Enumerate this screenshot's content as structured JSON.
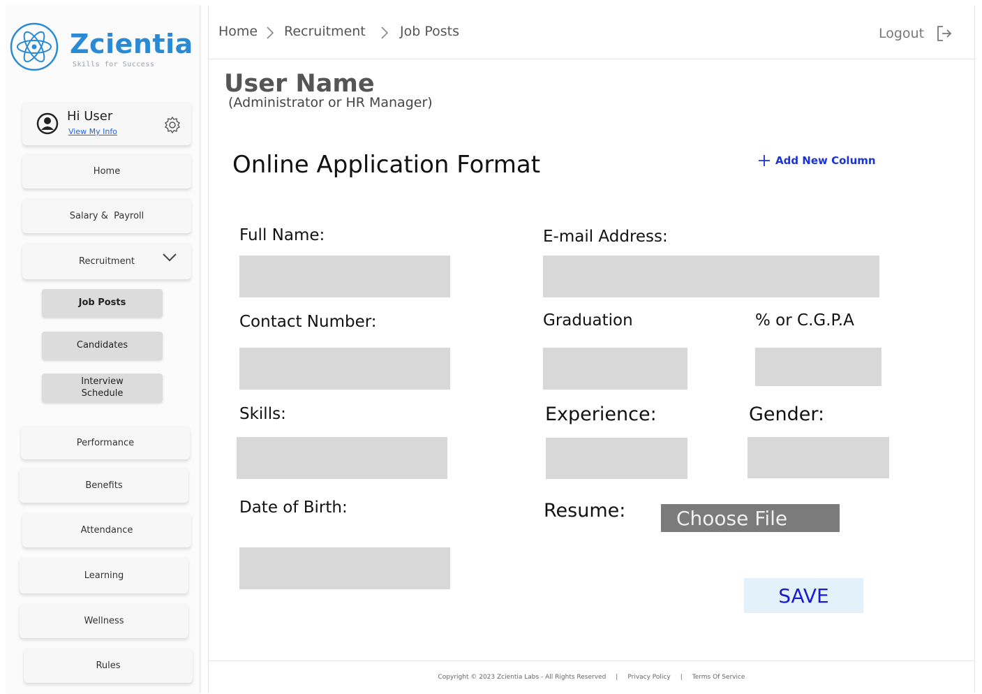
{
  "brand": {
    "name": "Zcientia",
    "tagline": "Skills for Success",
    "color": "#2a8ad4"
  },
  "user_card": {
    "greeting": "Hi User",
    "link": "View My Info"
  },
  "nav": {
    "home": "Home",
    "salary": "Salary &  Payroll",
    "recruitment": "Recruitment",
    "sub": {
      "job_posts": "Job Posts",
      "candidates": "Candidates",
      "interview": "Interview\nSchedule"
    },
    "performance": "Performance",
    "benefits": "Benefits",
    "attendance": "Attendance",
    "learning": "Learning",
    "wellness": "Wellness",
    "rules": "Rules"
  },
  "breadcrumb": [
    "Home",
    "Recruitment",
    "Job Posts"
  ],
  "logout": "Logout",
  "profile": {
    "name": "User Name",
    "role": "(Administrator or HR Manager)"
  },
  "form": {
    "title": "Online Application Format",
    "add_column": "Add New Column",
    "labels": {
      "full_name": "Full Name:",
      "email": "E-mail Address:",
      "contact": "Contact Number:",
      "graduation": "Graduation",
      "cgpa": "% or C.G.P.A",
      "skills": "Skills:",
      "experience": "Experience:",
      "gender": "Gender:",
      "dob": "Date of Birth:",
      "resume": "Resume:"
    },
    "choose_file": "Choose File",
    "save": "SAVE"
  },
  "footer": {
    "copyright": "Copyright © 2023 Zcientia Labs - All Rights Reserved",
    "sep": "|",
    "privacy": "Privacy Policy",
    "terms": "Terms Of Service"
  },
  "icons": [
    "atom-logo-icon",
    "user-avatar-icon",
    "gear-icon",
    "chevron-down-icon",
    "chevron-right-icon",
    "logout-icon",
    "plus-icon"
  ]
}
